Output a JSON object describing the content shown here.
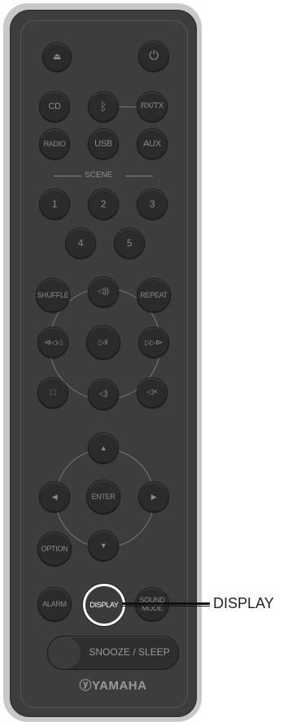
{
  "buttons": {
    "cd": "CD",
    "rxtx": "RX/TX",
    "radio": "RADIO",
    "usb": "USB",
    "aux": "AUX",
    "scene_label": "SCENE",
    "n1": "1",
    "n2": "2",
    "n3": "3",
    "n4": "4",
    "n5": "5",
    "shuffle": "SHUFFLE",
    "repeat": "REPEAT",
    "enter": "ENTER",
    "option": "OPTION",
    "alarm": "ALARM",
    "display": "DISPLAY",
    "sound_mode_1": "SOUND",
    "sound_mode_2": "MODE",
    "snooze_sleep": "SNOOZE / SLEEP"
  },
  "brand": "ⓨYAMAHA",
  "callout": "DISPLAY",
  "icons": {
    "eject": "⏏",
    "power": "⏻",
    "bluetooth": "ᛒ",
    "vol_up": "◁))",
    "prev": "⧏◁◁",
    "play_pause": "▷II",
    "next": "▷▷⧐",
    "stop": "□",
    "vol_down": "◁)",
    "mute": "◁×",
    "up": "▲",
    "down": "▼",
    "left": "◀",
    "right": "▶"
  }
}
